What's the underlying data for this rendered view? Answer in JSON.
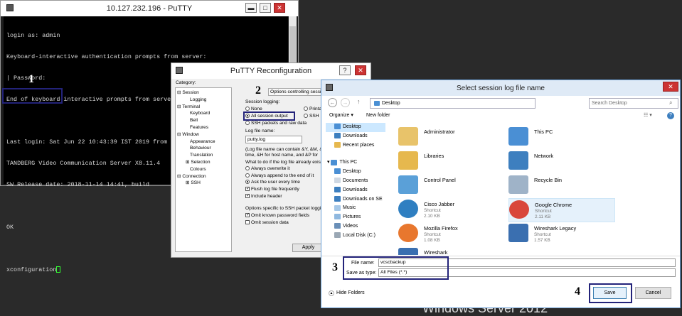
{
  "putty": {
    "title": "10.127.232.196 - PuTTY",
    "lines": [
      "login as: admin",
      "Keyboard-interactive authentication prompts from server:",
      "| Password:",
      "End of keyboard-interactive prompts from server",
      "",
      "Last login: Sat Jun 22 10:43:39 IST 2019 from 10.127.232.207 on pts/0",
      "TANDBERG Video Communication Server X8.11.4",
      "SW Release date: 2018-11-14 14:41, build",
      "",
      "OK",
      "",
      "xconfiguration"
    ],
    "controls": {
      "minimize": "▬",
      "maximize": "□",
      "close": "✕"
    }
  },
  "annotations": {
    "step1": "1",
    "step2": "2",
    "step3": "3",
    "step4": "4"
  },
  "reconfig": {
    "title": "PuTTY Reconfiguration",
    "category_label": "Category:",
    "tree": [
      "Session",
      "Logging",
      "Terminal",
      "Keyboard",
      "Bell",
      "Features",
      "Window",
      "Appearance",
      "Behaviour",
      "Translation",
      "Selection",
      "Colours",
      "Connection",
      "SSH"
    ],
    "header": "Options controlling session",
    "session_logging_label": "Session logging:",
    "opt_none": "None",
    "opt_printable": "Printa",
    "opt_all_output": "All session output",
    "opt_ssh": "SSH",
    "opt_ssh_packets": "SSH packets and raw data",
    "logfile_label": "Log file name:",
    "logfile_value": "putty.log",
    "help_line1": "(Log file name can contain &Y, &M, &",
    "help_line2": "time, &H for host name, and &P for",
    "exists_label": "What to do if the log file already exist",
    "opt_overwrite": "Always overwrite it",
    "opt_append": "Always append to the end of it",
    "opt_ask": "Ask the user every time",
    "chk_flush": "Flush log file frequently",
    "chk_header": "Include header",
    "ssh_opts_label": "Options specific to SSH packet loggi",
    "chk_omit_pw": "Omit known password fields",
    "chk_omit_data": "Omit session data",
    "apply": "Apply",
    "controls": {
      "minimize": "▬",
      "maximize": "□",
      "close": "✕"
    }
  },
  "dialog": {
    "title": "Select session log file name",
    "close": "✕",
    "address": "Desktop",
    "search_placeholder": "Search Desktop",
    "organize": "Organize ▾",
    "new_folder": "New folder",
    "nav": [
      "Desktop",
      "Downloads",
      "Recent places",
      "",
      "This PC",
      "Desktop",
      "Documents",
      "Downloads",
      "Downloads on SE",
      "Music",
      "Pictures",
      "Videos",
      "Local Disk (C:)"
    ],
    "items": [
      {
        "name": "Administrator",
        "type": "",
        "size": "",
        "color": "#e8c36a"
      },
      {
        "name": "This PC",
        "type": "",
        "size": "",
        "color": "#4a8fd4"
      },
      {
        "name": "Libraries",
        "type": "",
        "size": "",
        "color": "#e6b84e"
      },
      {
        "name": "Network",
        "type": "",
        "size": "",
        "color": "#3d7fbf"
      },
      {
        "name": "Control Panel",
        "type": "",
        "size": "",
        "color": "#5aa0d8"
      },
      {
        "name": "Recycle Bin",
        "type": "",
        "size": "",
        "color": "#9fb3c8"
      },
      {
        "name": "Cisco Jabber",
        "type": "Shortcut",
        "size": "2.10 KB",
        "color": "#2f7fc1"
      },
      {
        "name": "Google Chrome",
        "type": "Shortcut",
        "size": "2.11 KB",
        "color": "#d9463b"
      },
      {
        "name": "Mozilla Firefox",
        "type": "Shortcut",
        "size": "1.08 KB",
        "color": "#e8772e"
      },
      {
        "name": "Wireshark Legacy",
        "type": "Shortcut",
        "size": "1.57 KB",
        "color": "#3a6fb0"
      },
      {
        "name": "Wireshark",
        "type": "",
        "size": "",
        "color": "#3a6fb0"
      }
    ],
    "filename_label": "File name:",
    "filename_value": "vcscbackup",
    "savetype_label": "Save as type:",
    "savetype_value": "All Files (*.*)",
    "hide_folders": "Hide Folders",
    "save": "Save",
    "cancel": "Cancel"
  },
  "background_text": "Windows Server 2012"
}
